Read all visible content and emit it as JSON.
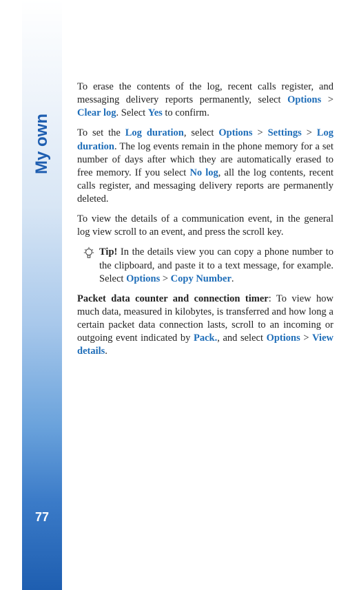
{
  "sidebar": {
    "title": "My own",
    "pageNumber": "77"
  },
  "paragraphs": {
    "p1": {
      "t1": "To erase the contents of the log, recent calls register, and messaging delivery reports permanently, select ",
      "options": "Options",
      "sep1": " > ",
      "clearLog": "Clear log",
      "t2": ". Select ",
      "yes": "Yes",
      "t3": " to confirm."
    },
    "p2": {
      "t1": "To set the ",
      "logDuration1": "Log duration",
      "t2": ", select ",
      "options": "Options",
      "sep1": " > ",
      "settings": "Settings",
      "sep2": " > ",
      "logDuration2": "Log duration",
      "t3": ". The log events remain in the phone memory for a set number of days after which they are automatically erased to free memory. If you select ",
      "noLog": "No log",
      "t4": ", all the log contents, recent calls register, and messaging delivery reports are permanently deleted."
    },
    "p3": {
      "t1": "To view the details of a communication event, in the general log view scroll to an event, and press the scroll key."
    },
    "tip": {
      "label": "Tip!",
      "t1": " In the details view you can copy a phone number to the clipboard, and paste it to a text message, for example. Select ",
      "options": "Options",
      "sep1": " > ",
      "copyNumber": "Copy Number",
      "t2": "."
    },
    "p4": {
      "heading": "Packet data counter and connection timer",
      "t1": ": To view how much data, measured in kilobytes, is transferred and how long a certain packet data connection lasts, scroll to an incoming or outgoing event indicated by ",
      "pack": "Pack.",
      "t2": ", and select ",
      "options": "Options",
      "sep1": " > ",
      "viewDetails": "View details",
      "t3": "."
    }
  }
}
